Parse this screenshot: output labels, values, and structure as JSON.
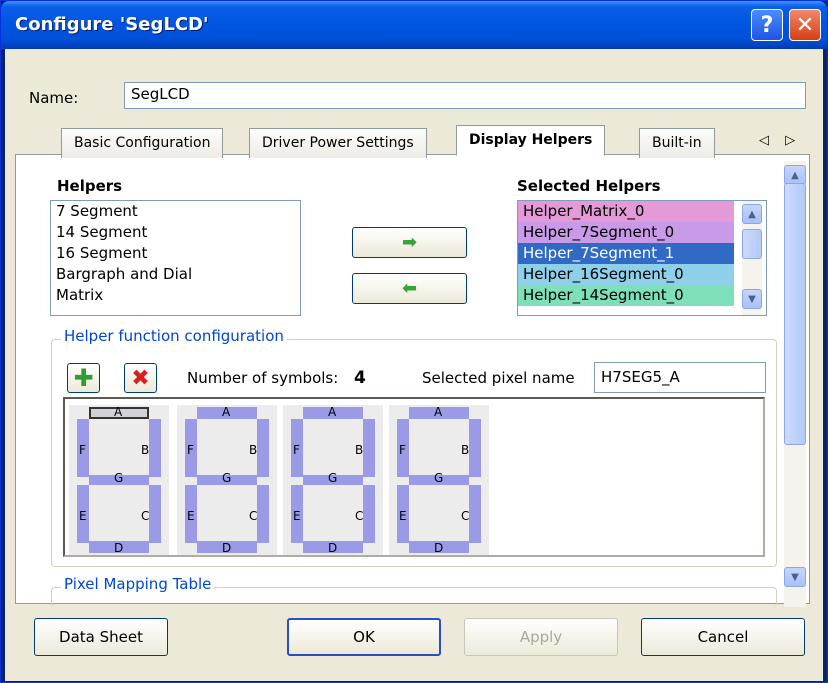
{
  "window": {
    "title": "Configure 'SegLCD'",
    "help_label": "?",
    "close_label": "✕"
  },
  "name": {
    "label": "Name:",
    "value": "SegLCD"
  },
  "tabs": [
    {
      "label": "Basic Configuration"
    },
    {
      "label": "Driver Power Settings"
    },
    {
      "label": "Display Helpers"
    },
    {
      "label": "Built-in"
    }
  ],
  "tab_arrows": "◁ ▷",
  "helpers": {
    "title": "Helpers",
    "items": [
      "7 Segment",
      "14 Segment",
      "16 Segment",
      "Bargraph and Dial",
      "Matrix"
    ]
  },
  "selected_helpers": {
    "title": "Selected Helpers",
    "items": [
      {
        "label": "Helper_Matrix_0",
        "color": "#e49ad8"
      },
      {
        "label": "Helper_7Segment_0",
        "color": "#c89ae8"
      },
      {
        "label": "Helper_7Segment_1",
        "color": "#316ac5"
      },
      {
        "label": "Helper_16Segment_0",
        "color": "#8ed0ea"
      },
      {
        "label": "Helper_14Segment_0",
        "color": "#7ee0b8"
      }
    ]
  },
  "helper_config": {
    "title": "Helper function configuration",
    "num_symbols_label": "Number of symbols:",
    "num_symbols_value": "4",
    "selected_pixel_label": "Selected pixel name",
    "selected_pixel_value": "H7SEG5_A"
  },
  "segments": [
    "A",
    "B",
    "C",
    "D",
    "E",
    "F",
    "G"
  ],
  "pixel_mapping_title": "Pixel Mapping Table",
  "buttons": {
    "data_sheet": "Data Sheet",
    "ok": "OK",
    "apply": "Apply",
    "cancel": "Cancel"
  },
  "colors": {
    "title_bar": "#0054e3",
    "segment": "#9a9ae6",
    "dialog_bg": "#ece9d8"
  }
}
